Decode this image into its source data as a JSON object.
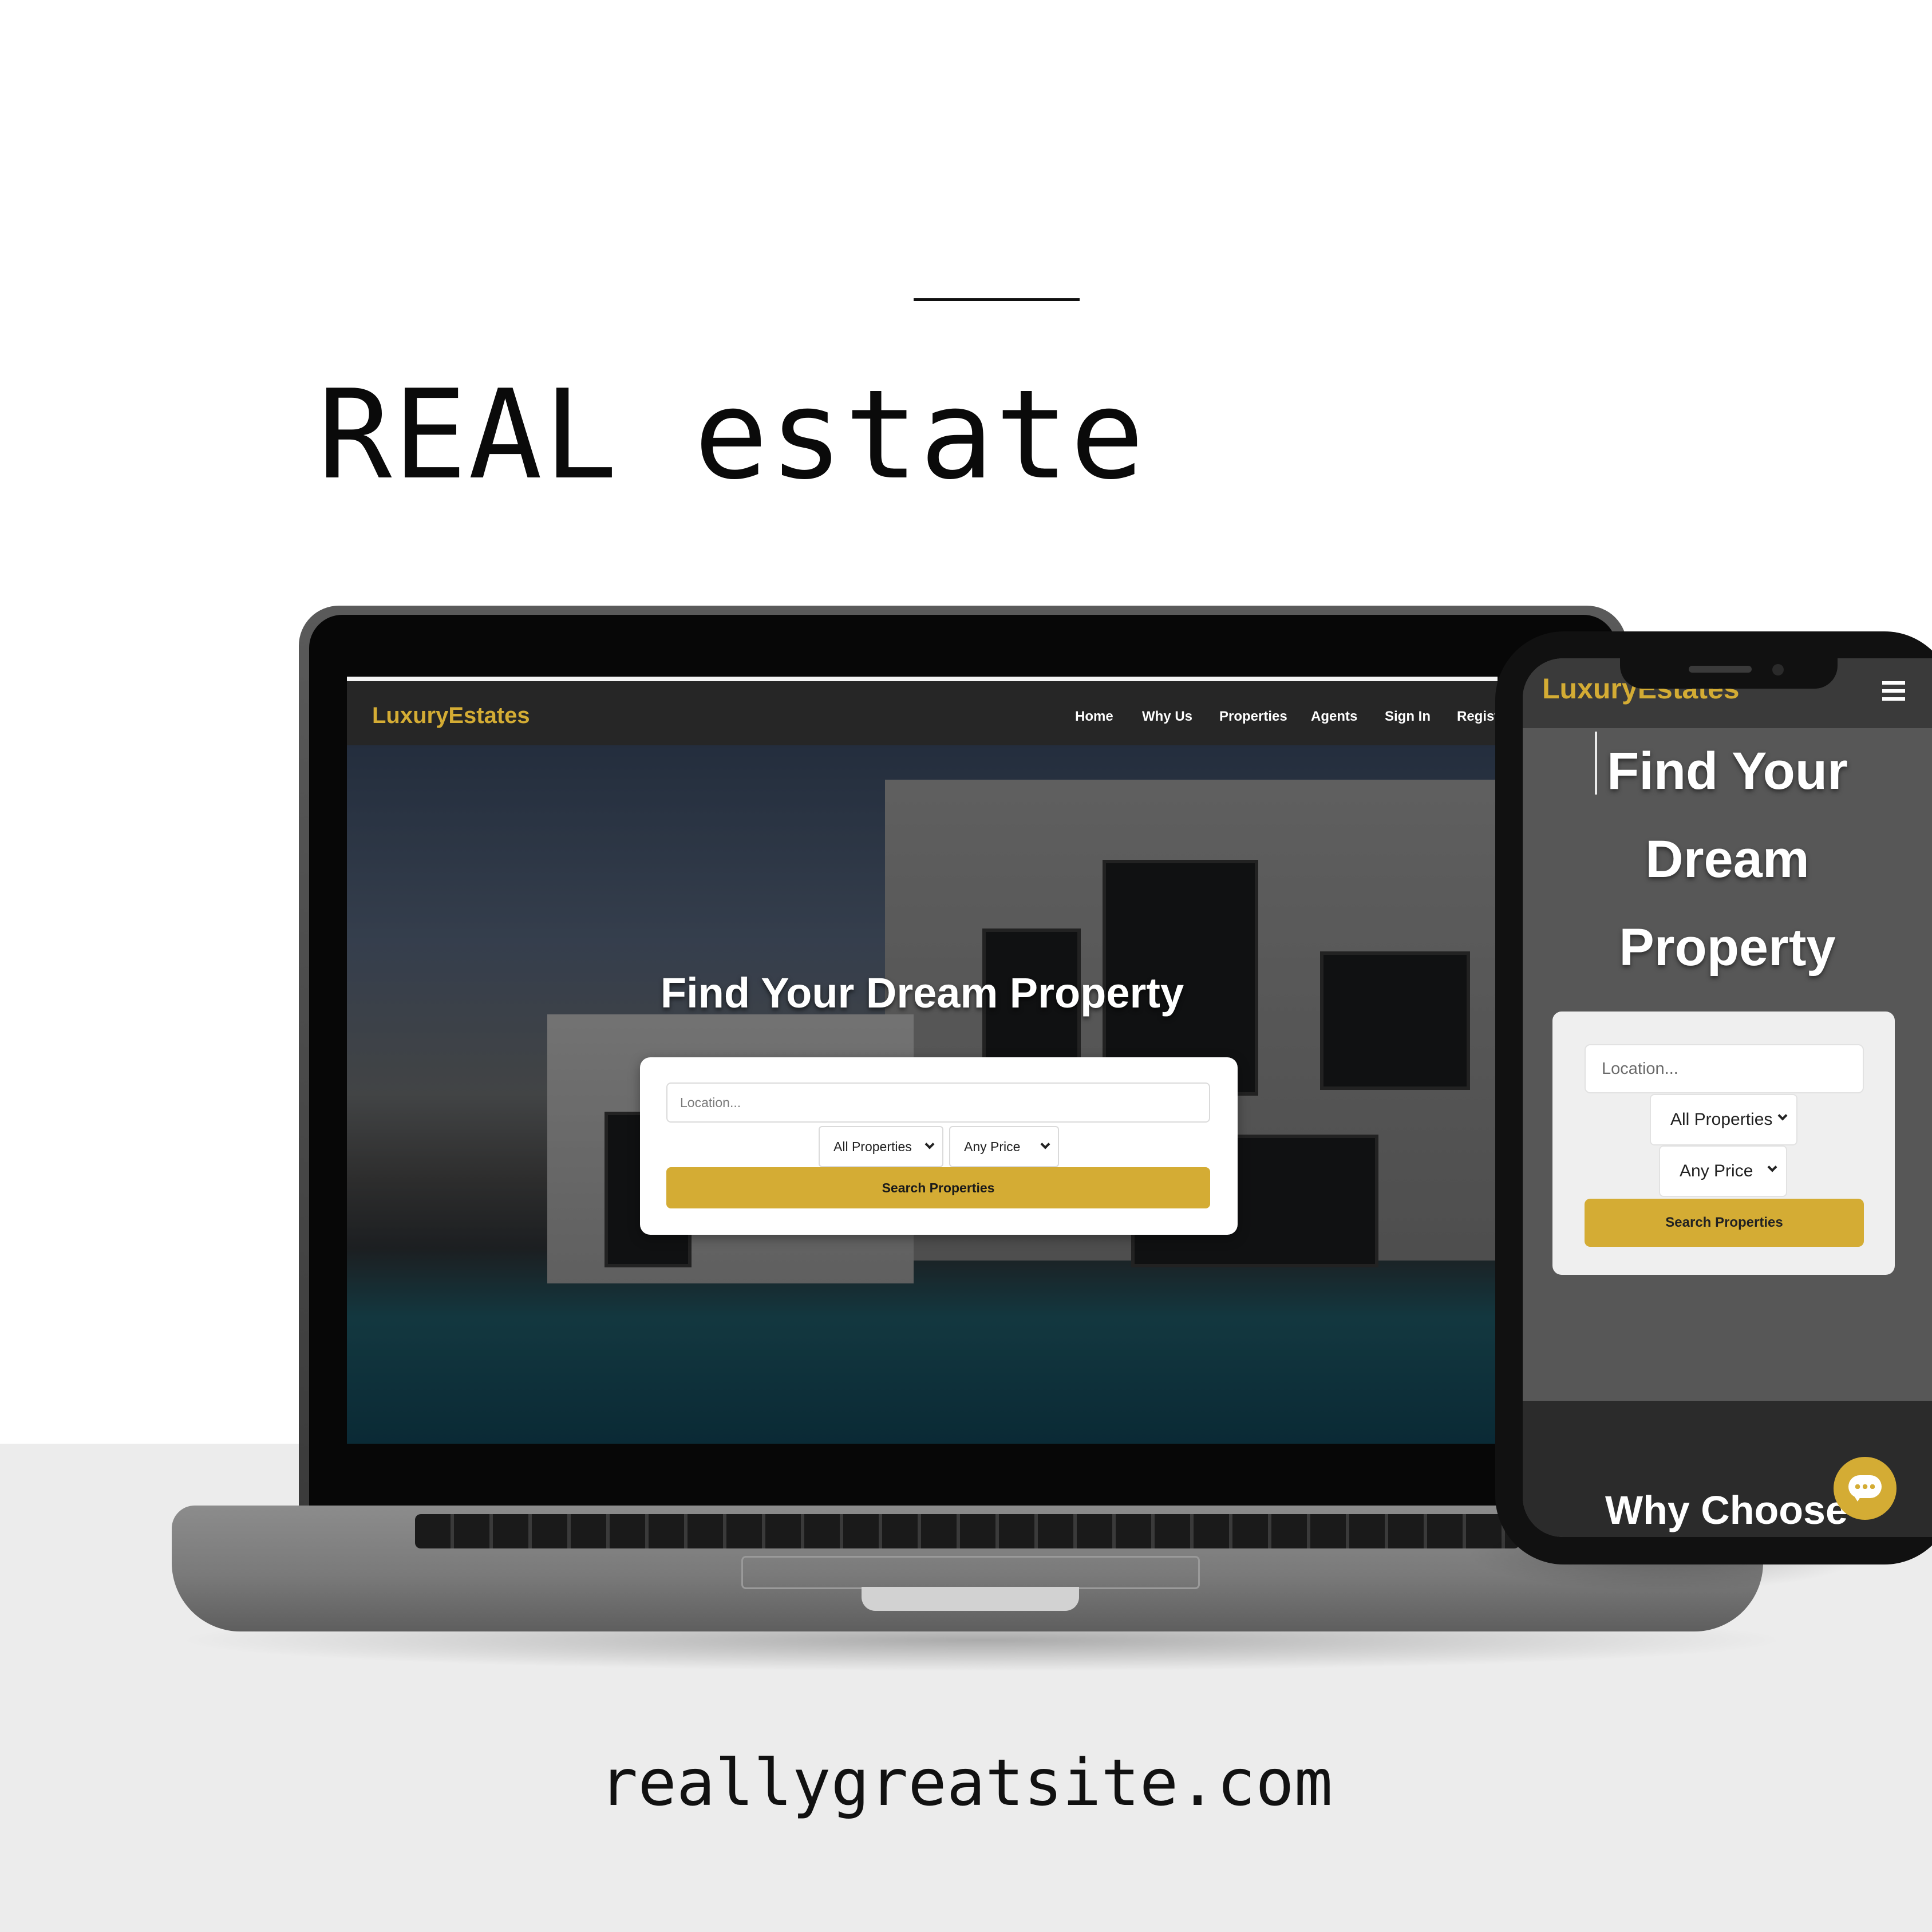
{
  "poster": {
    "headline": "REAL estate",
    "url": "reallygreatsite.com"
  },
  "brand": {
    "name": "LuxuryEstates",
    "accent_color": "#d4ac34"
  },
  "desktop": {
    "nav": [
      "Home",
      "Why Us",
      "Properties",
      "Agents",
      "Sign In",
      "Regist"
    ],
    "hero_title": "Find Your Dream Property",
    "search": {
      "location_placeholder": "Location...",
      "type_selected": "All Properties",
      "price_selected": "Any Price",
      "button_label": "Search Properties"
    }
  },
  "mobile": {
    "logo": "LuxuryEstates",
    "menu_icon": "hamburger-icon",
    "hero_title_lines": [
      "Find Your",
      "Dream",
      "Property"
    ],
    "search": {
      "location_placeholder": "Location...",
      "type_selected": "All Properties",
      "price_selected": "Any Price",
      "button_label": "Search Properties"
    },
    "section_heading": "Why Choose",
    "chat_icon": "chat-icon"
  }
}
